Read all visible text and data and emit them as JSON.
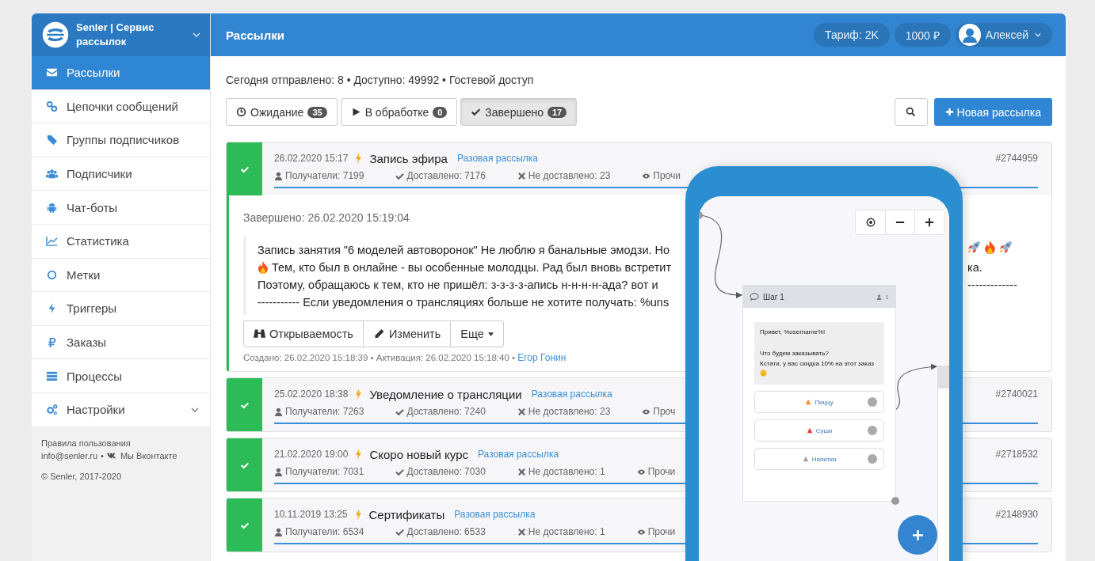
{
  "brand": {
    "name": "Senler | Сервис рассылок"
  },
  "sidebar": {
    "items": [
      {
        "label": "Рассылки",
        "selected": true,
        "expandable": false
      },
      {
        "label": "Цепочки сообщений",
        "selected": false,
        "expandable": false
      },
      {
        "label": "Группы подписчиков",
        "selected": false,
        "expandable": false
      },
      {
        "label": "Подписчики",
        "selected": false,
        "expandable": false
      },
      {
        "label": "Чат-боты",
        "selected": false,
        "expandable": false
      },
      {
        "label": "Статистика",
        "selected": false,
        "expandable": false
      },
      {
        "label": "Метки",
        "selected": false,
        "expandable": false
      },
      {
        "label": "Триггеры",
        "selected": false,
        "expandable": false
      },
      {
        "label": "Заказы",
        "selected": false,
        "expandable": false
      },
      {
        "label": "Процессы",
        "selected": false,
        "expandable": false
      },
      {
        "label": "Настройки",
        "selected": false,
        "expandable": true
      }
    ],
    "footer": {
      "terms": "Правила пользования",
      "email": "info@senler.ru",
      "separator": "•",
      "vk": "Мы Вконтакте",
      "copyright": "© Senler, 2017-2020"
    }
  },
  "header": {
    "title": "Рассылки",
    "tariff": "Тариф: 2K",
    "balance": "1000 ₽",
    "user": "Алексей"
  },
  "summary": "Сегодня отправлено: 8 • Доступно: 49992 • Гостевой доступ",
  "tabs": [
    {
      "label": "Ожидание",
      "count": "35",
      "selected": false
    },
    {
      "label": "В обработке",
      "count": "0",
      "selected": false
    },
    {
      "label": "Завершено",
      "count": "17",
      "selected": true
    }
  ],
  "new_button": "Новая рассылка",
  "mailings": [
    {
      "date": "26.02.2020 15:17",
      "title": "Запись эфира",
      "type": "Разовая рассылка",
      "id": "#2744959",
      "recipients": "Получатели: 7199",
      "delivered": "Доставлено: 7176",
      "failed": "Не доставлено: 23",
      "read": "Прочи",
      "expanded": true,
      "details": {
        "finished": "Завершено: 26.02.2020 15:19:04",
        "lines": [
          {
            "text": "Запись занятия \"6 моделей автоворонок\" Не люблю я банальные эмодзи. Но"
          },
          {
            "text": "Тем, кто был в онлайне - вы особенные молодцы. Рад был вновь встретит",
            "tail": "ка."
          },
          {
            "text": "Поэтому, обращаюсь к тем, кто не пришёл: з-з-з-з-апись н-н-н-н-ада? вот и",
            "tail": "-------------"
          },
          {
            "text": "----------- Если уведомления о трансляциях больше не хотите получать: %uns"
          }
        ],
        "buttons": [
          "Открываемость",
          "Изменить",
          "Еще"
        ],
        "meta": "Создано: 26.02.2020 15:18:39 • Активация: 26.02.2020 15:18:40 •",
        "author": "Егор Гонин"
      }
    },
    {
      "date": "25.02.2020 18:38",
      "title": "Уведомление о трансляции",
      "type": "Разовая рассылка",
      "id": "#2740021",
      "recipients": "Получатели: 7263",
      "delivered": "Доставлено: 7240",
      "failed": "Не доставлено: 23",
      "read": "Проч",
      "expanded": false
    },
    {
      "date": "21.02.2020 19:00",
      "title": "Скоро новый курс",
      "type": "Разовая рассылка",
      "id": "#2718532",
      "recipients": "Получатели: 7031",
      "delivered": "Доставлено: 7030",
      "failed": "Не доставлено: 1",
      "read": "Прочи",
      "expanded": false
    },
    {
      "date": "10.11.2019 13:25",
      "title": "Сертификаты",
      "type": "Разовая рассылка",
      "id": "#2148930",
      "recipients": "Получатели: 6534",
      "delivered": "Доставлено: 6533",
      "failed": "Не доставлено: 1",
      "read": "Прочи",
      "expanded": false
    }
  ],
  "phone": {
    "node": {
      "title": "Шаг 1",
      "count": "1",
      "paragraphs": [
        [
          "Привет, %username%!"
        ],
        [
          "Что будем заказывать?",
          "Кстати, у вас скидка 10% на этот заказ"
        ]
      ],
      "buttons": [
        "Пиццу",
        "Суши",
        "Напитки"
      ]
    }
  }
}
